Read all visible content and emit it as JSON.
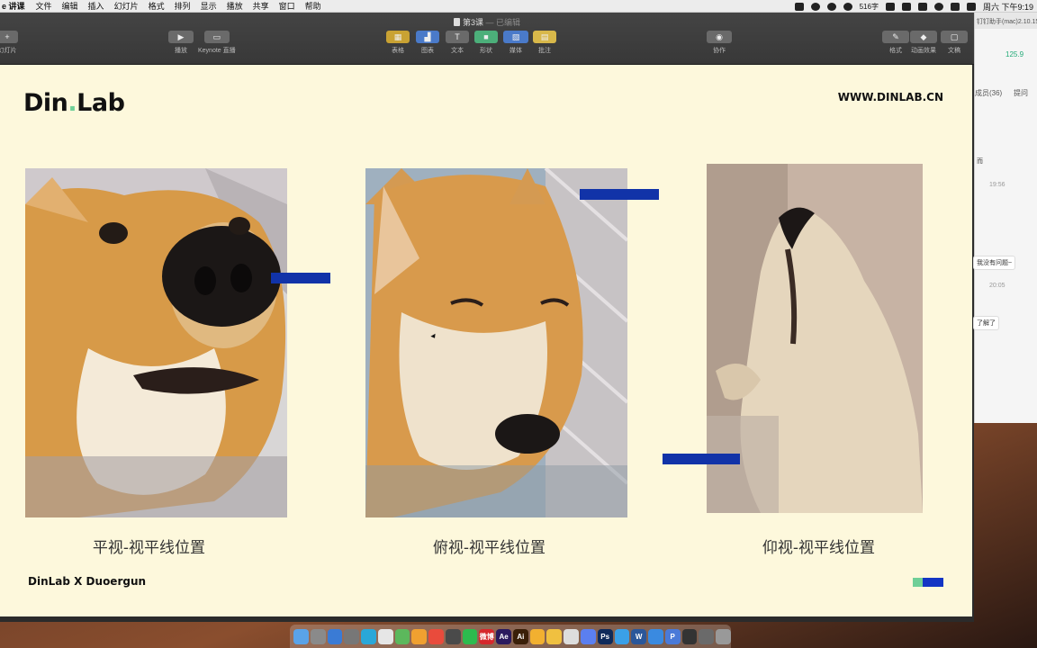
{
  "menubar": {
    "app_name": "e 讲课",
    "items": [
      "文件",
      "编辑",
      "插入",
      "幻灯片",
      "格式",
      "排列",
      "显示",
      "播放",
      "共享",
      "窗口",
      "帮助"
    ],
    "word_count": "516字",
    "clock": "周六 下午9:19"
  },
  "keynote": {
    "doc_title": "第3课",
    "doc_status": "— 已编辑",
    "toolbar": {
      "add_slide": "幻灯片",
      "play": "播放",
      "keynote_live": "Keynote 直播",
      "table": "表格",
      "chart": "图表",
      "text": "文本",
      "shape": "形状",
      "media": "媒体",
      "comment": "批注",
      "collaborate": "协作",
      "format": "格式",
      "animate": "动画效果",
      "document": "文稿"
    }
  },
  "slide": {
    "logo_left": "Din",
    "logo_dot": ".",
    "logo_right": "Lab",
    "website": "WWW.DINLAB.CN",
    "footer": "DinLab X Duoergun",
    "captions": [
      "平视-视平线位置",
      "俯视-视平线位置",
      "仰视-视平线位置"
    ],
    "accent_color": "#1133a8",
    "footer_colors": [
      "#6fcf97",
      "#1335c4"
    ]
  },
  "chat": {
    "header": "钉钉助手(mac)2.10.15",
    "signal": "125.9",
    "tab_left": "成员(36)",
    "tab_right": "提问",
    "msg1": "而",
    "time1": "19:56",
    "bubble1": "我没有问题~",
    "time2": "20:05",
    "bubble2": "了解了"
  },
  "dock": {
    "icons": [
      "finder-icon",
      "launchpad-icon",
      "safari-icon",
      "system-prefs-icon",
      "telegram-icon",
      "calendar-icon",
      "maps-icon",
      "photos-icon",
      "chrome-icon",
      "quicktime-icon",
      "wechat-icon",
      "weibo-icon",
      "after-effects-icon",
      "illustrator-icon",
      "sketch-icon",
      "scheduler-icon",
      "soccer-icon",
      "cloud-icon",
      "photoshop-icon",
      "browser-icon",
      "word-icon",
      "keynote-icon",
      "pages-icon",
      "folder-icon",
      "downloads-icon",
      "trash-icon"
    ],
    "labels": [
      "",
      "",
      "",
      "",
      "",
      "",
      "",
      "",
      "",
      "",
      "",
      "微博",
      "Ae",
      "Ai",
      "",
      "",
      "",
      "",
      "Ps",
      "",
      "W",
      "",
      "P",
      "",
      "",
      ""
    ]
  }
}
